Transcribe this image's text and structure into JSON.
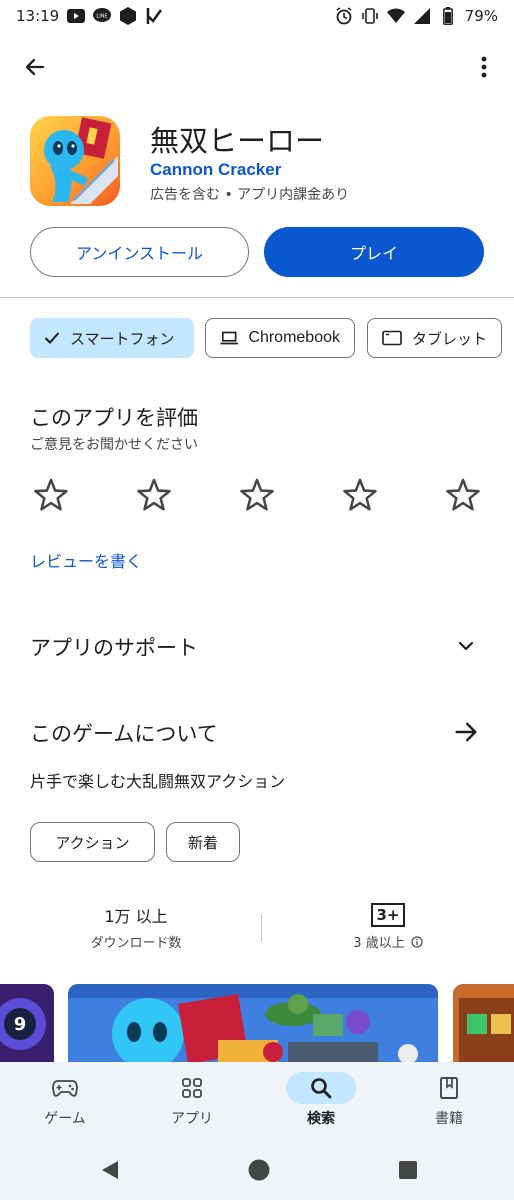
{
  "status_bar": {
    "time": "13:19",
    "battery": "79%"
  },
  "app": {
    "title": "無双ヒーロー",
    "developer": "Cannon Cracker",
    "meta": "広告を含む • アプリ内課金あり"
  },
  "actions": {
    "uninstall": "アンインストール",
    "play": "プレイ"
  },
  "devices": [
    {
      "label": "スマートフォン",
      "selected": true
    },
    {
      "label": "Chromebook",
      "selected": false
    },
    {
      "label": "タブレット",
      "selected": false
    }
  ],
  "rating": {
    "title": "このアプリを評価",
    "subtitle": "ご意見をお聞かせください",
    "stars": 5,
    "write_review": "レビューを書く"
  },
  "support": {
    "title": "アプリのサポート"
  },
  "about": {
    "title": "このゲームについて",
    "description": "片手で楽しむ大乱闘無双アクション",
    "tags": [
      "アクション",
      "新着"
    ]
  },
  "stats": {
    "downloads_value": "1万 以上",
    "downloads_label": "ダウンロード数",
    "age_badge": "3+",
    "age_label": "3 歳以上"
  },
  "bottom_nav": [
    {
      "label": "ゲーム",
      "icon": "gamepad-icon",
      "active": false
    },
    {
      "label": "アプリ",
      "icon": "apps-grid-icon",
      "active": false
    },
    {
      "label": "検索",
      "icon": "search-icon",
      "active": true
    },
    {
      "label": "書籍",
      "icon": "book-icon",
      "active": false
    }
  ],
  "colors": {
    "accent": "#0b57d0",
    "chip_selected": "#c2e7ff",
    "nav_bg": "#f0f4f9"
  }
}
